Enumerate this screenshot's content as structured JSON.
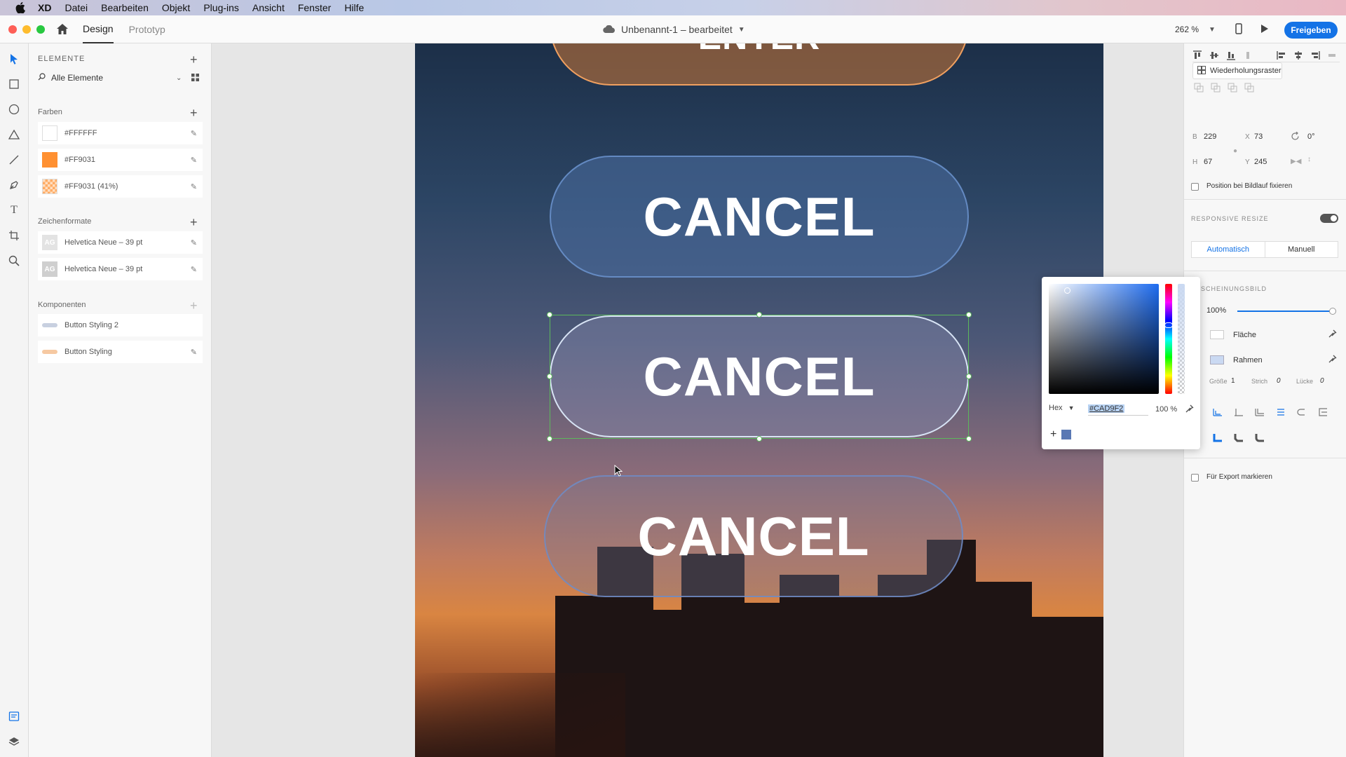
{
  "menubar": {
    "items": [
      "XD",
      "Datei",
      "Bearbeiten",
      "Objekt",
      "Plug-ins",
      "Ansicht",
      "Fenster",
      "Hilfe"
    ]
  },
  "topbar": {
    "tabs": [
      "Design",
      "Prototyp"
    ],
    "doc_title": "Unbenannt-1 – bearbeitet",
    "zoom": "262 %",
    "share_label": "Freigeben"
  },
  "assets": {
    "title": "ELEMENTE",
    "search_placeholder": "Alle Elemente",
    "colors_title": "Farben",
    "colors": [
      {
        "label": "#FFFFFF",
        "color": "#FFFFFF"
      },
      {
        "label": "#FF9031",
        "color": "#FF9031"
      },
      {
        "label": "#FF9031 (41%)",
        "color": "#FF9031"
      }
    ],
    "char_title": "Zeichenformate",
    "char_styles": [
      {
        "label": "Helvetica Neue – 39 pt",
        "thumb": "AG"
      },
      {
        "label": "Helvetica Neue – 39 pt",
        "thumb": "AG"
      }
    ],
    "comp_title": "Komponenten",
    "components": [
      {
        "label": "Button Styling 2",
        "color": "#c8d0e0"
      },
      {
        "label": "Button Styling",
        "color": "#f6c9a2"
      }
    ]
  },
  "artboard": {
    "top_button_label": "ENTER",
    "buttons": [
      "CANCEL",
      "CANCEL",
      "CANCEL"
    ]
  },
  "picker": {
    "mode": "Hex",
    "hex": "#CAD9F2",
    "opacity": "100 %",
    "swatch_color": "#5a78b4"
  },
  "inspector": {
    "repeat_grid": "Wiederholungsraster",
    "w_label": "B",
    "w": "229",
    "x_label": "X",
    "x": "73",
    "rotation": "0°",
    "h_label": "H",
    "h": "67",
    "y_label": "Y",
    "y": "245",
    "fix_position": "Position bei Bildlauf fixieren",
    "responsive_resize": "RESPONSIVE RESIZE",
    "auto": "Automatisch",
    "manual": "Manuell",
    "appearance": "SCHEINUNGSBILD",
    "opacity": "100%",
    "opacity_level": 1.0,
    "fill": "Fläche",
    "border": "Rahmen",
    "size_label": "Größe",
    "size": "1",
    "dash_label": "Strich",
    "dash": "0",
    "gap_label": "Lücke",
    "gap": "0",
    "export": "Für Export markieren"
  }
}
